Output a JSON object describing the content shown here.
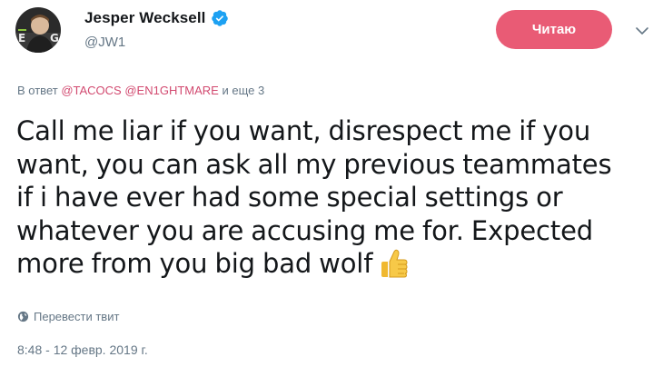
{
  "author": {
    "display_name": "Jesper Wecksell",
    "handle": "@JW1",
    "verified": true
  },
  "follow_button": {
    "label": "Читаю",
    "color": "#e95b75"
  },
  "reply": {
    "prefix": "В ответ",
    "mention_1": "@TACOCS",
    "mention_2": "@EN1GHTMARE",
    "suffix": "и еще 3"
  },
  "tweet": {
    "lines": [
      "Call me liar if you want, disrespect me if you",
      "want, you can ask all my previous teammates",
      "if i have ever had some special settings or",
      "whatever you are accusing me for. Expected",
      "more from you big bad wolf"
    ],
    "emoji": "thumbs-up-icon"
  },
  "translate_label": "Перевести твит",
  "timestamp": "8:48 - 12 февр. 2019 г.",
  "colors": {
    "mention": "#d24a70",
    "secondary_text": "#657786",
    "verified": "#1da1f2"
  }
}
